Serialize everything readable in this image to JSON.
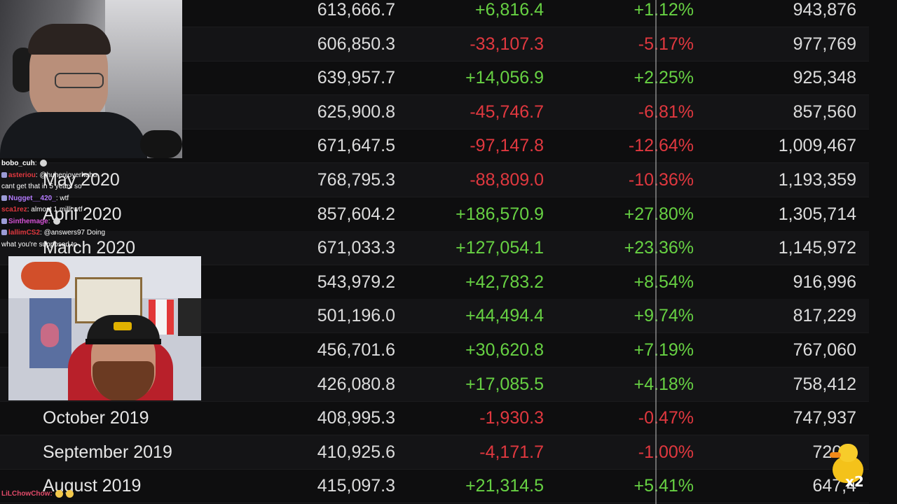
{
  "stats_table": {
    "rows": [
      {
        "month": "",
        "avg": "613,666.7",
        "gain": "+6,816.4",
        "gain_pct": "+1.12%",
        "peak": "943,876",
        "trend": "pos"
      },
      {
        "month": "",
        "avg": "606,850.3",
        "gain": "-33,107.3",
        "gain_pct": "-5.17%",
        "peak": "977,769",
        "trend": "neg"
      },
      {
        "month": "",
        "avg": "639,957.7",
        "gain": "+14,056.9",
        "gain_pct": "+2.25%",
        "peak": "925,348",
        "trend": "pos"
      },
      {
        "month": "",
        "avg": "625,900.8",
        "gain": "-45,746.7",
        "gain_pct": "-6.81%",
        "peak": "857,560",
        "trend": "neg"
      },
      {
        "month": "",
        "avg": "671,647.5",
        "gain": "-97,147.8",
        "gain_pct": "-12.64%",
        "peak": "1,009,467",
        "trend": "neg"
      },
      {
        "month": "May 2020",
        "avg": "768,795.3",
        "gain": "-88,809.0",
        "gain_pct": "-10.36%",
        "peak": "1,193,359",
        "trend": "neg"
      },
      {
        "month": "April 2020",
        "avg": "857,604.2",
        "gain": "+186,570.9",
        "gain_pct": "+27.80%",
        "peak": "1,305,714",
        "trend": "pos"
      },
      {
        "month": "March 2020",
        "avg": "671,033.3",
        "gain": "+127,054.1",
        "gain_pct": "+23.36%",
        "peak": "1,145,972",
        "trend": "pos"
      },
      {
        "month": "",
        "avg": "543,979.2",
        "gain": "+42,783.2",
        "gain_pct": "+8.54%",
        "peak": "916,996",
        "trend": "pos"
      },
      {
        "month": "",
        "avg": "501,196.0",
        "gain": "+44,494.4",
        "gain_pct": "+9.74%",
        "peak": "817,229",
        "trend": "pos"
      },
      {
        "month": "",
        "avg": "456,701.6",
        "gain": "+30,620.8",
        "gain_pct": "+7.19%",
        "peak": "767,060",
        "trend": "pos"
      },
      {
        "month": "",
        "avg": "426,080.8",
        "gain": "+17,085.5",
        "gain_pct": "+4.18%",
        "peak": "758,412",
        "trend": "pos"
      },
      {
        "month": "October 2019",
        "avg": "408,995.3",
        "gain": "-1,930.3",
        "gain_pct": "-0.47%",
        "peak": "747,937",
        "trend": "neg"
      },
      {
        "month": "September 2019",
        "avg": "410,925.6",
        "gain": "-4,171.7",
        "gain_pct": "-1.00%",
        "peak": "720,0",
        "trend": "neg"
      },
      {
        "month": "August 2019",
        "avg": "415,097.3",
        "gain": "+21,314.5",
        "gain_pct": "+5.41%",
        "peak": "647,4",
        "trend": "pos"
      }
    ]
  },
  "chat": {
    "messages": [
      {
        "user": "bobo_cuh",
        "text": "",
        "color": "#ffffff"
      },
      {
        "user": "asteriou",
        "text": "@huhenjoyerhuhu",
        "color": "#e0383f"
      },
      {
        "user": "",
        "text": "cant get that in 5 years so",
        "color": "#ffffff"
      },
      {
        "user": "Nugget__420_",
        "text": "wtf",
        "color": "#b57cff"
      },
      {
        "user": "sca1rez",
        "text": "almost 1 milli wtf",
        "color": "#e0383f"
      },
      {
        "user": "Sinthemage",
        "text": "",
        "color": "#d452d4"
      },
      {
        "user": "lallimCS2",
        "text": "@answers97 Doing",
        "color": "#e0383f"
      },
      {
        "user": "",
        "text": "what you're supposed to",
        "color": "#ffffff"
      }
    ],
    "bottom_user": "LiLChowChow"
  },
  "overlay": {
    "duck_label": "x2"
  },
  "colors": {
    "positive": "#67d143",
    "negative": "#e0383f",
    "background": "#0e0e0f"
  }
}
